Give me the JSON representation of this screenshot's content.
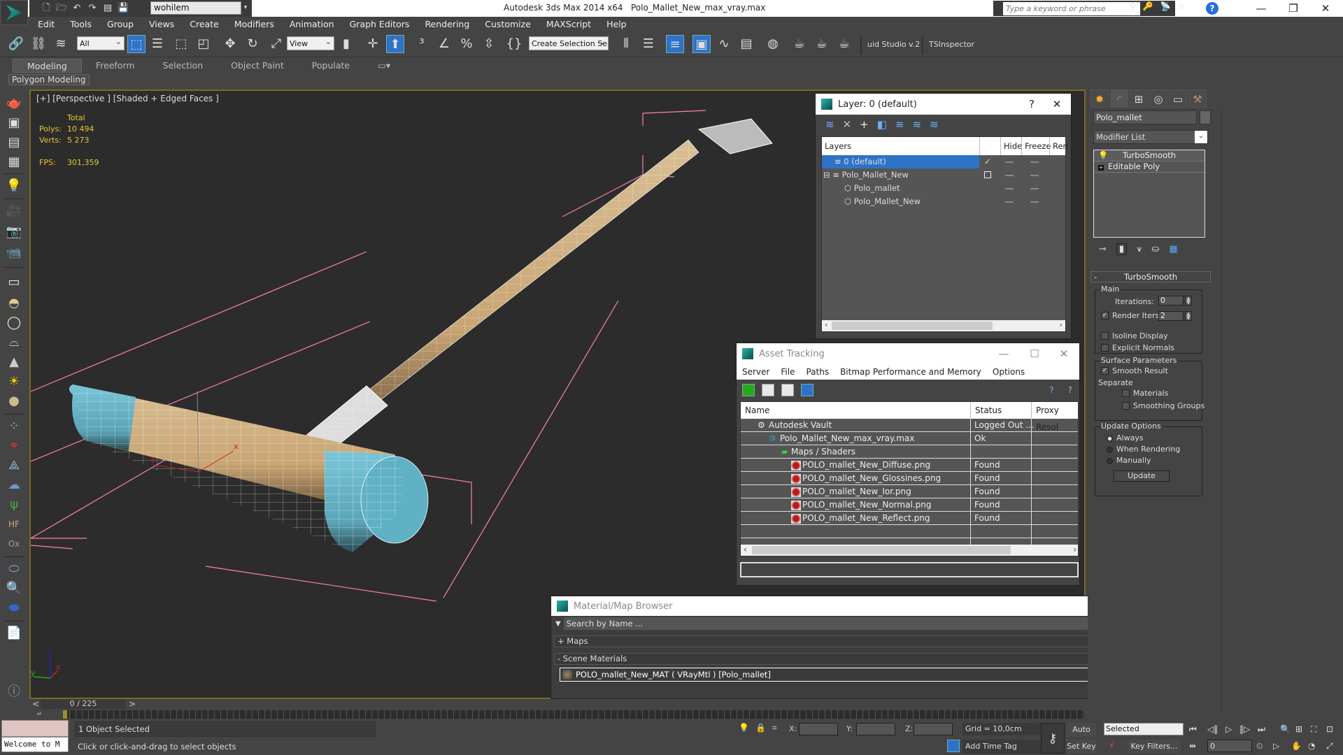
{
  "app": {
    "title": "Autodesk 3ds Max  2014 x64",
    "filename": "Polo_Mallet_New_max_vray.max",
    "workspace": "wohilem",
    "search_placeholder": "Type a keyword or phrase"
  },
  "menu": [
    "Edit",
    "Tools",
    "Group",
    "Views",
    "Create",
    "Modifiers",
    "Animation",
    "Graph Editors",
    "Rendering",
    "Customize",
    "MAXScript",
    "Help"
  ],
  "toolbar": {
    "selection_filter": "All",
    "ref_coord": "View",
    "named_selection": "Create Selection Se",
    "plugin1": "uid Studio v.2",
    "plugin2": "TSInspector"
  },
  "ribbon": {
    "tabs": [
      "Modeling",
      "Freeform",
      "Selection",
      "Object Paint",
      "Populate"
    ],
    "active": "Modeling",
    "panel": "Polygon Modeling"
  },
  "viewport": {
    "label": "[+] [Perspective ] [Shaded + Edged Faces ]",
    "stats": {
      "total_label": "Total",
      "polys_label": "Polys:",
      "polys": "10 494",
      "verts_label": "Verts:",
      "verts": "5 273",
      "fps_label": "FPS:",
      "fps": "301,359"
    },
    "axis": {
      "x": "x",
      "y": "y",
      "z": "z"
    }
  },
  "layer_dialog": {
    "title": "Layer: 0 (default)",
    "help": "?",
    "columns": [
      "Layers",
      "Hide",
      "Freeze",
      "Ren"
    ],
    "rows": [
      {
        "name": "0 (default)",
        "selected": true,
        "active": true
      },
      {
        "name": "Polo_Mallet_New",
        "selected": false,
        "active": false
      },
      {
        "name": "Polo_mallet",
        "selected": false,
        "child": true
      },
      {
        "name": "Polo_Mallet_New",
        "selected": false,
        "child": true
      }
    ]
  },
  "asset_tracking": {
    "title": "Asset Tracking",
    "menu": [
      "Server",
      "File",
      "Paths",
      "Bitmap Performance and Memory",
      "Options"
    ],
    "columns": [
      "Name",
      "Status",
      "Proxy Resol"
    ],
    "rows": [
      {
        "name": "Autodesk Vault",
        "status": "Logged Out ..."
      },
      {
        "name": "Polo_Mallet_New_max_vray.max",
        "status": "Ok"
      },
      {
        "name": "Maps / Shaders",
        "status": ""
      },
      {
        "name": "POLO_mallet_New_Diffuse.png",
        "status": "Found"
      },
      {
        "name": "POLO_mallet_New_Glossines.png",
        "status": "Found"
      },
      {
        "name": "POLO_mallet_New_Ior.png",
        "status": "Found"
      },
      {
        "name": "POLO_mallet_New_Normal.png",
        "status": "Found"
      },
      {
        "name": "POLO_mallet_New_Reflect.png",
        "status": "Found"
      }
    ]
  },
  "material_browser": {
    "title": "Material/Map Browser",
    "search_placeholder": "Search by Name ...",
    "groups": [
      "+ Maps",
      "- Scene Materials"
    ],
    "item": "POLO_mallet_New_MAT ( VRayMtl ) [Polo_mallet]"
  },
  "command_panel": {
    "object_name": "Polo_mallet",
    "modifier_list": "Modifier List",
    "stack": [
      "TurboSmooth",
      "Editable Poly"
    ],
    "turbosmooth": {
      "title": "TurboSmooth",
      "main_label": "Main",
      "iterations_label": "Iterations:",
      "iterations": "0",
      "render_iters_label": "Render Iters:",
      "render_iters": "2",
      "render_iters_checked": true,
      "isoline_label": "Isoline Display",
      "isoline_checked": false,
      "explicit_normals_label": "Explicit Normals",
      "explicit_normals_checked": false,
      "surface_label": "Surface Parameters",
      "smooth_result_label": "Smooth Result",
      "smooth_result_checked": true,
      "separate_label": "Separate",
      "materials_label": "Materials",
      "smoothing_groups_label": "Smoothing Groups",
      "update_label": "Update Options",
      "always_label": "Always",
      "when_rendering_label": "When Rendering",
      "manually_label": "Manually",
      "update_mode": "Always",
      "update_button": "Update"
    }
  },
  "timeline": {
    "frame": "0 / 225"
  },
  "status": {
    "maxscript_text": "Welcome to M",
    "selection": "1 Object Selected",
    "prompt": "Click or click-and-drag to select objects",
    "x_label": "X:",
    "y_label": "Y:",
    "z_label": "Z:",
    "grid": "Grid = 10,0cm",
    "add_time_tag": "Add Time Tag",
    "auto_key": "Auto Key",
    "set_key": "Set Key",
    "key_mode": "Selected",
    "key_filters": "Key Filters...",
    "current_frame": "0"
  }
}
